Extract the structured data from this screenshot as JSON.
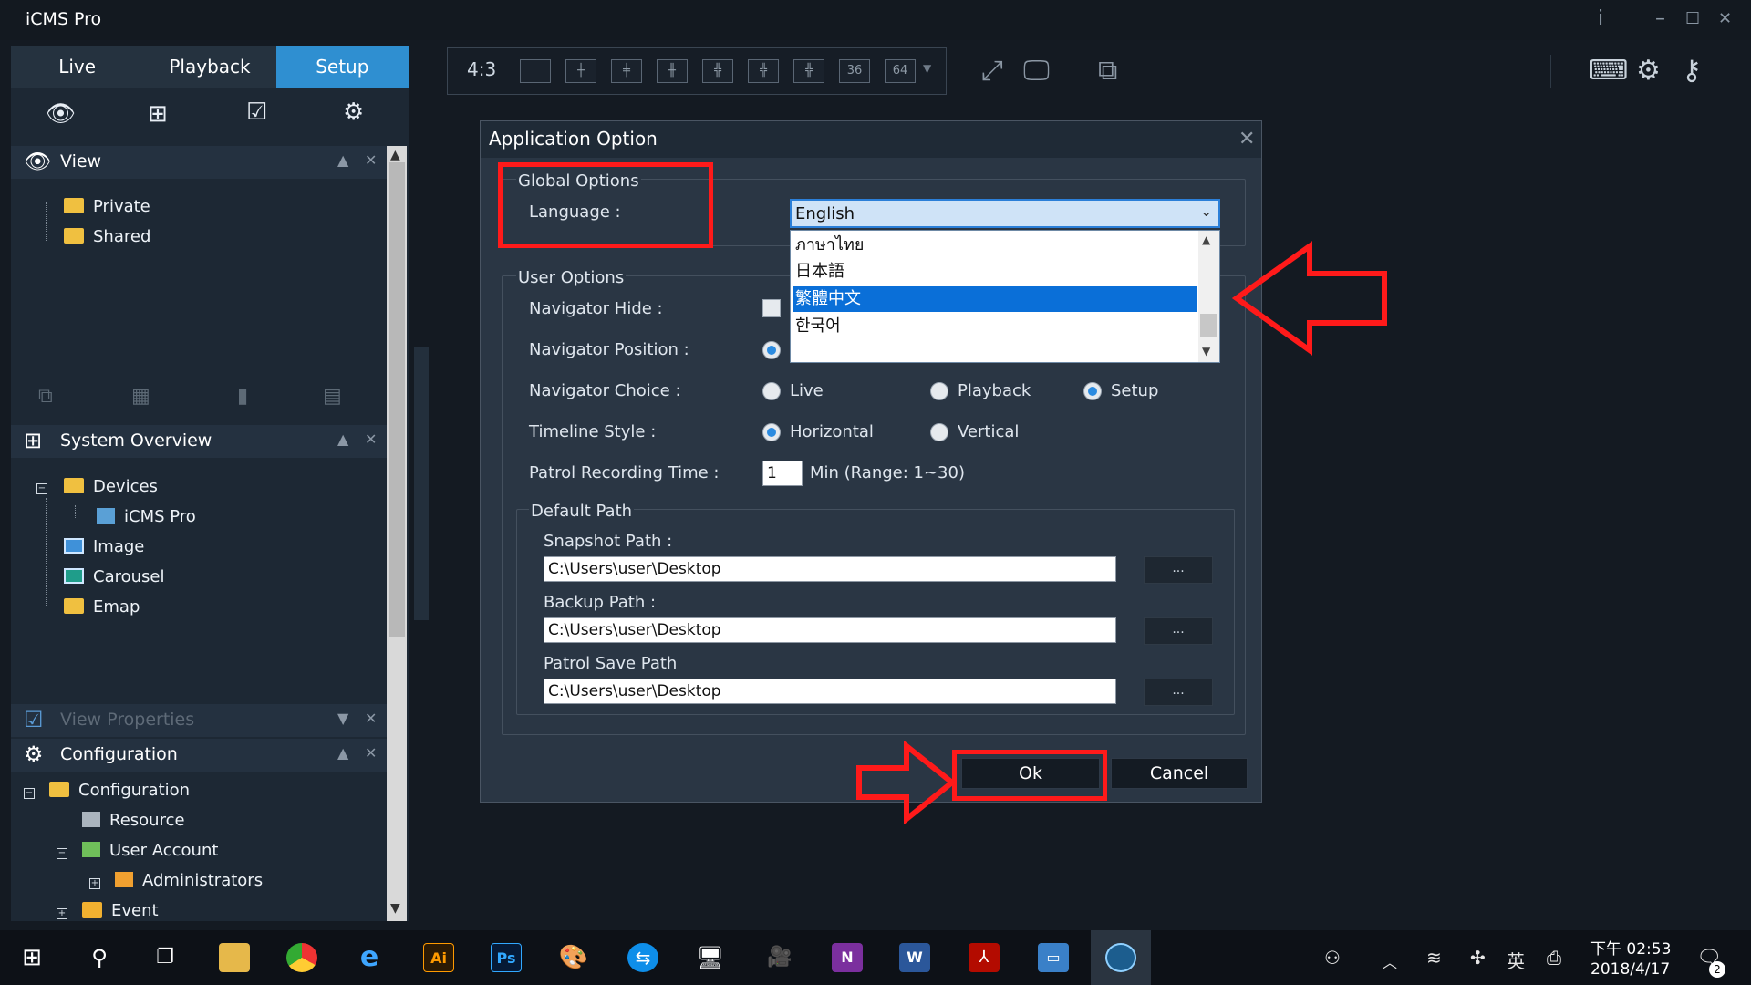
{
  "app": {
    "title": "iCMS Pro"
  },
  "window_controls": {
    "info": "i",
    "minimize": "–",
    "maximize": "☐",
    "close": "✕"
  },
  "nav_tabs": [
    {
      "label": "Live"
    },
    {
      "label": "Playback"
    },
    {
      "label": "Setup"
    }
  ],
  "view_section": {
    "title": "View",
    "items": [
      {
        "label": "Private"
      },
      {
        "label": "Shared"
      }
    ]
  },
  "system_overview": {
    "title": "System Overview",
    "items": [
      {
        "label": "Devices"
      },
      {
        "label": "iCMS Pro"
      },
      {
        "label": "Image"
      },
      {
        "label": "Carousel"
      },
      {
        "label": "Emap"
      }
    ]
  },
  "view_properties": {
    "title": "View Properties"
  },
  "configuration": {
    "title": "Configuration",
    "items": [
      {
        "label": "Configuration"
      },
      {
        "label": "Resource"
      },
      {
        "label": "User Account"
      },
      {
        "label": "Administrators"
      },
      {
        "label": "Event"
      }
    ]
  },
  "layout_toolbar": {
    "ratio": "4:3",
    "layout_36": "36",
    "layout_64": "64"
  },
  "dialog": {
    "title": "Application Option",
    "close": "✕",
    "global_options": {
      "title": "Global Options",
      "language_label": "Language :",
      "language_value": "English",
      "language_options": [
        "ภาษาไทย",
        "日本語",
        "繁體中文",
        "한국어"
      ],
      "selected_option": "繁體中文"
    },
    "user_options": {
      "title": "User Options",
      "navigator_hide_label": "Navigator Hide :",
      "navigator_position_label": "Navigator Position :",
      "navigator_choice_label": "Navigator Choice :",
      "choice_live": "Live",
      "choice_playback": "Playback",
      "choice_setup": "Setup",
      "timeline_style_label": "Timeline Style :",
      "timeline_horizontal": "Horizontal",
      "timeline_vertical": "Vertical",
      "patrol_time_label": "Patrol Recording Time :",
      "patrol_time_value": "1",
      "patrol_time_unit": "Min (Range: 1~30)"
    },
    "default_path": {
      "title": "Default Path",
      "snapshot_label": "Snapshot Path :",
      "snapshot_value": "C:\\Users\\user\\Desktop",
      "backup_label": "Backup Path :",
      "backup_value": "C:\\Users\\user\\Desktop",
      "patrol_label": "Patrol Save Path",
      "patrol_value": "C:\\Users\\user\\Desktop",
      "browse": "..."
    },
    "ok": "Ok",
    "cancel": "Cancel"
  },
  "taskbar": {
    "time": "下午 02:53",
    "date": "2018/4/17",
    "ime": "英",
    "notifications": "2",
    "ai_label": "Ai",
    "ps_label": "Ps"
  },
  "colors": {
    "accent": "#2f8fd1",
    "annotation_red": "#ff1a1a",
    "selection_blue": "#0a6fd8"
  }
}
